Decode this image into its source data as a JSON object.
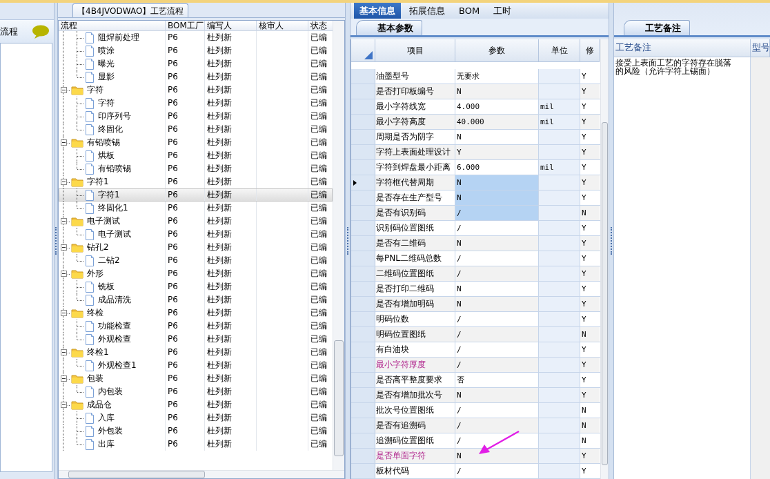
{
  "left_pane": {
    "title": "流程"
  },
  "process_tree": {
    "title": "【4B4JVODWAO】工艺流程",
    "columns": [
      "流程",
      "BOM工厂",
      "编写人",
      "核审人",
      "状态"
    ],
    "nodes": [
      {
        "children": [
          {
            "label": "阻焊前处理",
            "kind": "file",
            "bom": "P6",
            "author": "杜列新",
            "status": "已编",
            "selected": false
          },
          {
            "label": "喷涂",
            "kind": "file",
            "bom": "P6",
            "author": "杜列新",
            "status": "已编",
            "selected": false
          },
          {
            "label": "曝光",
            "kind": "file",
            "bom": "P6",
            "author": "杜列新",
            "status": "已编",
            "selected": false
          },
          {
            "label": "显影",
            "kind": "file",
            "bom": "P6",
            "author": "杜列新",
            "status": "已编",
            "selected": false
          }
        ]
      },
      {
        "label": "字符",
        "kind": "folder",
        "expanded": true,
        "bom": "P6",
        "author": "杜列新",
        "status": "已编",
        "selected": false,
        "children": [
          {
            "label": "字符",
            "kind": "file",
            "bom": "P6",
            "author": "杜列新",
            "status": "已编",
            "selected": false
          },
          {
            "label": "印序列号",
            "kind": "file",
            "bom": "P6",
            "author": "杜列新",
            "status": "已编",
            "selected": false
          },
          {
            "label": "终固化",
            "kind": "file",
            "bom": "P6",
            "author": "杜列新",
            "status": "已编",
            "selected": false
          }
        ]
      },
      {
        "label": "有铅喷锡",
        "kind": "folder",
        "expanded": true,
        "bom": "P6",
        "author": "杜列新",
        "status": "已编",
        "selected": false,
        "children": [
          {
            "label": "烘板",
            "kind": "file",
            "bom": "P6",
            "author": "杜列新",
            "status": "已编",
            "selected": false
          },
          {
            "label": "有铅喷锡",
            "kind": "file",
            "bom": "P6",
            "author": "杜列新",
            "status": "已编",
            "selected": false
          }
        ]
      },
      {
        "label": "字符1",
        "kind": "folder",
        "expanded": true,
        "bom": "P6",
        "author": "杜列新",
        "status": "已编",
        "selected": false,
        "children": [
          {
            "label": "字符1",
            "kind": "file",
            "bom": "P6",
            "author": "杜列新",
            "status": "已编",
            "selected": true
          },
          {
            "label": "终固化1",
            "kind": "file",
            "bom": "P6",
            "author": "杜列新",
            "status": "已编",
            "selected": false
          }
        ]
      },
      {
        "label": "电子测试",
        "kind": "folder",
        "expanded": true,
        "bom": "P6",
        "author": "杜列新",
        "status": "已编",
        "selected": false,
        "children": [
          {
            "label": "电子测试",
            "kind": "file",
            "bom": "P6",
            "author": "杜列新",
            "status": "已编",
            "selected": false
          }
        ]
      },
      {
        "label": "钻孔2",
        "kind": "folder",
        "expanded": true,
        "bom": "P6",
        "author": "杜列新",
        "status": "已编",
        "selected": false,
        "children": [
          {
            "label": "二钻2",
            "kind": "file",
            "bom": "P6",
            "author": "杜列新",
            "status": "已编",
            "selected": false
          }
        ]
      },
      {
        "label": "外形",
        "kind": "folder",
        "expanded": true,
        "bom": "P6",
        "author": "杜列新",
        "status": "已编",
        "selected": false,
        "children": [
          {
            "label": "铣板",
            "kind": "file",
            "bom": "P6",
            "author": "杜列新",
            "status": "已编",
            "selected": false
          },
          {
            "label": "成品清洗",
            "kind": "file",
            "bom": "P6",
            "author": "杜列新",
            "status": "已编",
            "selected": false
          }
        ]
      },
      {
        "label": "终检",
        "kind": "folder",
        "expanded": true,
        "bom": "P6",
        "author": "杜列新",
        "status": "已编",
        "selected": false,
        "children": [
          {
            "label": "功能检查",
            "kind": "file",
            "bom": "P6",
            "author": "杜列新",
            "status": "已编",
            "selected": false
          },
          {
            "label": "外观检查",
            "kind": "file",
            "bom": "P6",
            "author": "杜列新",
            "status": "已编",
            "selected": false
          }
        ]
      },
      {
        "label": "终检1",
        "kind": "folder",
        "expanded": true,
        "bom": "P6",
        "author": "杜列新",
        "status": "已编",
        "selected": false,
        "children": [
          {
            "label": "外观检查1",
            "kind": "file",
            "bom": "P6",
            "author": "杜列新",
            "status": "已编",
            "selected": false
          }
        ]
      },
      {
        "label": "包装",
        "kind": "folder",
        "expanded": true,
        "bom": "P6",
        "author": "杜列新",
        "status": "已编",
        "selected": false,
        "children": [
          {
            "label": "内包装",
            "kind": "file",
            "bom": "P6",
            "author": "杜列新",
            "status": "已编",
            "selected": false
          }
        ]
      },
      {
        "label": "成品仓",
        "kind": "folder",
        "expanded": true,
        "bom": "P6",
        "author": "杜列新",
        "status": "已编",
        "selected": false,
        "children": [
          {
            "label": "入库",
            "kind": "file",
            "bom": "P6",
            "author": "杜列新",
            "status": "已编",
            "selected": false
          },
          {
            "label": "外包装",
            "kind": "file",
            "bom": "P6",
            "author": "杜列新",
            "status": "已编",
            "selected": false
          },
          {
            "label": "出库",
            "kind": "file",
            "bom": "P6",
            "author": "杜列新",
            "status": "已编",
            "selected": false
          }
        ]
      }
    ]
  },
  "tabs": [
    {
      "label": "基本信息",
      "selected": true
    },
    {
      "label": "拓展信息",
      "selected": false
    },
    {
      "label": "BOM",
      "selected": false
    },
    {
      "label": "工时",
      "selected": false
    }
  ],
  "params": {
    "tab": "基本参数",
    "columns": [
      "项目",
      "参数",
      "单位",
      "修"
    ],
    "rows": [
      {
        "item": "油墨型号",
        "value": "无要求",
        "flag": "Y",
        "highlighted": false,
        "selected": false,
        "current": false
      },
      {
        "item": "是否打印板编号",
        "value": "N",
        "flag": "Y",
        "highlighted": false,
        "selected": false,
        "current": false
      },
      {
        "item": "最小字符线宽",
        "value": "4.000",
        "unit": "mil",
        "flag": "Y",
        "highlighted": false,
        "selected": false,
        "current": false
      },
      {
        "item": "最小字符高度",
        "value": "40.000",
        "unit": "mil",
        "flag": "Y",
        "highlighted": false,
        "selected": false,
        "current": false
      },
      {
        "item": "周期是否为阴字",
        "value": "N",
        "flag": "Y",
        "highlighted": false,
        "selected": false,
        "current": false
      },
      {
        "item": "字符上表面处理设计",
        "value": "Y",
        "flag": "Y",
        "highlighted": false,
        "selected": false,
        "current": false
      },
      {
        "item": "字符到焊盘最小距离",
        "value": "6.000",
        "unit": "mil",
        "flag": "Y",
        "highlighted": false,
        "selected": false,
        "current": false
      },
      {
        "item": "字符框代替周期",
        "value": "N",
        "flag": "Y",
        "highlighted": false,
        "selected": true,
        "current": true
      },
      {
        "item": "是否存在生产型号",
        "value": "N",
        "flag": "Y",
        "highlighted": false,
        "selected": true,
        "current": false
      },
      {
        "item": "是否有识别码",
        "value": "/",
        "flag": "N",
        "highlighted": false,
        "selected": true,
        "current": false
      },
      {
        "item": "识别码位置图纸",
        "value": "/",
        "flag": "Y",
        "highlighted": false,
        "selected": false,
        "current": false
      },
      {
        "item": "是否有二维码",
        "value": "N",
        "flag": "Y",
        "highlighted": false,
        "selected": false,
        "current": false
      },
      {
        "item": "每PNL二维码总数",
        "value": "/",
        "flag": "Y",
        "highlighted": false,
        "selected": false,
        "current": false
      },
      {
        "item": "二维码位置图纸",
        "value": "/",
        "flag": "Y",
        "highlighted": false,
        "selected": false,
        "current": false
      },
      {
        "item": "是否打印二维码",
        "value": "N",
        "flag": "Y",
        "highlighted": false,
        "selected": false,
        "current": false
      },
      {
        "item": "是否有增加明码",
        "value": "N",
        "flag": "Y",
        "highlighted": false,
        "selected": false,
        "current": false
      },
      {
        "item": "明码位数",
        "value": "/",
        "flag": "Y",
        "highlighted": false,
        "selected": false,
        "current": false
      },
      {
        "item": "明码位置图纸",
        "value": "/",
        "flag": "N",
        "highlighted": false,
        "selected": false,
        "current": false
      },
      {
        "item": "有白油块",
        "value": "/",
        "flag": "Y",
        "highlighted": false,
        "selected": false,
        "current": false
      },
      {
        "item": "最小字符厚度",
        "value": "/",
        "flag": "Y",
        "highlighted": true,
        "selected": false,
        "current": false
      },
      {
        "item": "是否高平整度要求",
        "value": "否",
        "flag": "Y",
        "highlighted": false,
        "selected": false,
        "current": false
      },
      {
        "item": "是否有增加批次号",
        "value": "N",
        "flag": "Y",
        "highlighted": false,
        "selected": false,
        "current": false
      },
      {
        "item": "批次号位置图纸",
        "value": "/",
        "flag": "N",
        "highlighted": false,
        "selected": false,
        "current": false
      },
      {
        "item": "是否有追溯码",
        "value": "/",
        "flag": "N",
        "highlighted": false,
        "selected": false,
        "current": false
      },
      {
        "item": "追溯码位置图纸",
        "value": "/",
        "flag": "N",
        "highlighted": false,
        "selected": false,
        "current": false
      },
      {
        "item": "是否单面字符",
        "value": "N",
        "flag": "Y",
        "highlighted": true,
        "selected": false,
        "current": false
      },
      {
        "item": "板材代码",
        "value": "/",
        "flag": "Y",
        "highlighted": false,
        "selected": false,
        "current": false
      }
    ]
  },
  "notes": {
    "tab": "工艺备注",
    "columns": [
      "工艺备注",
      "型号"
    ],
    "text": "接受上表面工艺的字符存在脱落的风险（允许字符上锡面）"
  }
}
